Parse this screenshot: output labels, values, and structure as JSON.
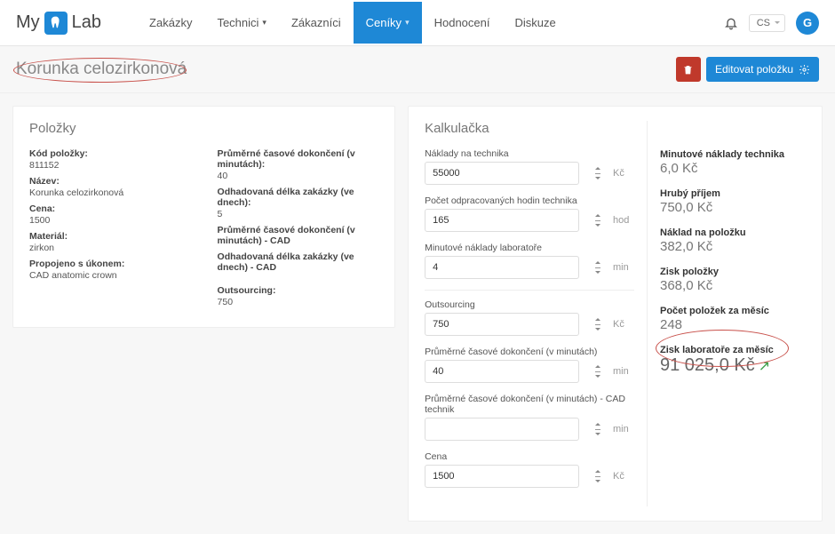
{
  "brand": {
    "prefix": "My",
    "suffix": "Lab"
  },
  "nav": {
    "zakazky": "Zakázky",
    "technici": "Technici",
    "zakaznici": "Zákazníci",
    "ceniky": "Ceníky",
    "hodnoceni": "Hodnocení",
    "diskuze": "Diskuze"
  },
  "lang": "CS",
  "avatar": "G",
  "page_title": "Korunka celozirkonová",
  "actions": {
    "edit": "Editovat položku"
  },
  "items": {
    "title": "Položky",
    "kod_label": "Kód položky:",
    "kod": "811152",
    "nazev_label": "Název:",
    "nazev": "Korunka celozirkonová",
    "cena_label": "Cena:",
    "cena": "1500",
    "material_label": "Materiál:",
    "material": "zirkon",
    "propojeno_label": "Propojeno s úkonem:",
    "propojeno": "CAD anatomic crown",
    "prum_cas_label": "Průměrné časové dokončení (v minutách):",
    "prum_cas": "40",
    "odhad_dny_label": "Odhadovaná délka zakázky (ve dnech):",
    "odhad_dny": "5",
    "prum_cas_cad_label": "Průměrné časové dokončení (v minutách) - CAD",
    "odhad_dny_cad_label": "Odhadovaná délka zakázky (ve dnech) - CAD",
    "outsourcing_label": "Outsourcing:",
    "outsourcing": "750"
  },
  "calc": {
    "title": "Kalkulačka",
    "naklady_tech_label": "Náklady na technika",
    "naklady_tech": "55000",
    "naklady_tech_unit": "Kč",
    "hodin_label": "Počet odpracovaných hodin technika",
    "hodin": "165",
    "hodin_unit": "hod",
    "min_naklady_label": "Minutové náklady laboratoře",
    "min_naklady": "4",
    "min_naklady_unit": "min",
    "outsourcing_label": "Outsourcing",
    "outsourcing": "750",
    "outsourcing_unit": "Kč",
    "prum_cas_label": "Průměrné časové dokončení (v minutách)",
    "prum_cas": "40",
    "prum_cas_unit": "min",
    "prum_cas_cad_label": "Průměrné časové dokončení (v minutách) - CAD technik",
    "prum_cas_cad": "",
    "prum_cas_cad_unit": "min",
    "cena_label": "Cena",
    "cena": "1500",
    "cena_unit": "Kč"
  },
  "summary": {
    "min_tech_label": "Minutové náklady technika",
    "min_tech": "6,0 Kč",
    "hruby_label": "Hrubý příjem",
    "hruby": "750,0 Kč",
    "naklad_pol_label": "Náklad na položku",
    "naklad_pol": "382,0 Kč",
    "zisk_pol_label": "Zisk položky",
    "zisk_pol": "368,0 Kč",
    "pocet_label": "Počet položek za měsíc",
    "pocet": "248",
    "zisk_lab_label": "Zisk laboratoře za měsíc",
    "zisk_lab": "91 025,0 Kč"
  }
}
